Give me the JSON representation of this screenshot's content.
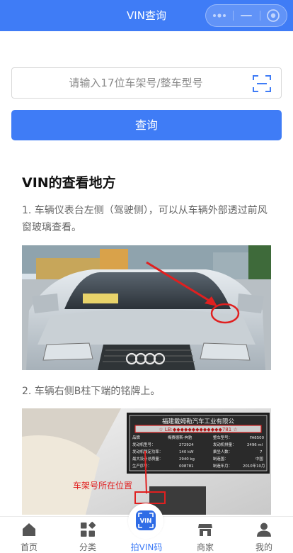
{
  "header": {
    "title": "VIN查询"
  },
  "search": {
    "placeholder": "请输入17位车架号/整车型号",
    "value": ""
  },
  "query_button": "查询",
  "section": {
    "title": "VIN的查看地方",
    "step1": "1. 车辆仪表台左侧（驾驶侧），可以从车辆外部透过前风窗玻璃查看。",
    "step2": "2. 车辆右侧B柱下端的铭牌上。"
  },
  "photo2_text": {
    "plate_title": "福建戴姆勒汽车工业有限公",
    "plate_vin": "☆ LB:◆◆◆◆◆◆◆◆◆◆◆◆◆781 ☆",
    "row1_left": "品牌",
    "row1_mid": "梅赛德斯-奔驰",
    "row1_right": "整车型号：",
    "row1_val": "FA6500",
    "row2_left": "发动机型号：",
    "row2_mid": "272924",
    "row2_right": "发动机排量：",
    "row2_val": "2496 ml",
    "row3_left": "发动机额定功率：",
    "row3_mid": "140 kW",
    "row3_right": "乘坐人数：",
    "row3_val": "7",
    "row4_left": "最大设计总质量：",
    "row4_mid": "2940 kg",
    "row4_right": "制造国：",
    "row4_val": "中国",
    "row5_left": "生产序号：",
    "row5_mid": "008781",
    "row5_right": "制造年月：",
    "row5_val": "2010年10月",
    "caption": "车架号所在位置"
  },
  "tabbar": {
    "items": [
      {
        "label": "首页",
        "icon": "home-icon"
      },
      {
        "label": "分类",
        "icon": "category-icon"
      },
      {
        "label": "拍VIN码",
        "icon": "vin-scan-icon"
      },
      {
        "label": "商家",
        "icon": "store-icon"
      },
      {
        "label": "我的",
        "icon": "user-icon"
      }
    ]
  },
  "colors": {
    "primary": "#3f7cf6",
    "text_gray": "#666666"
  }
}
